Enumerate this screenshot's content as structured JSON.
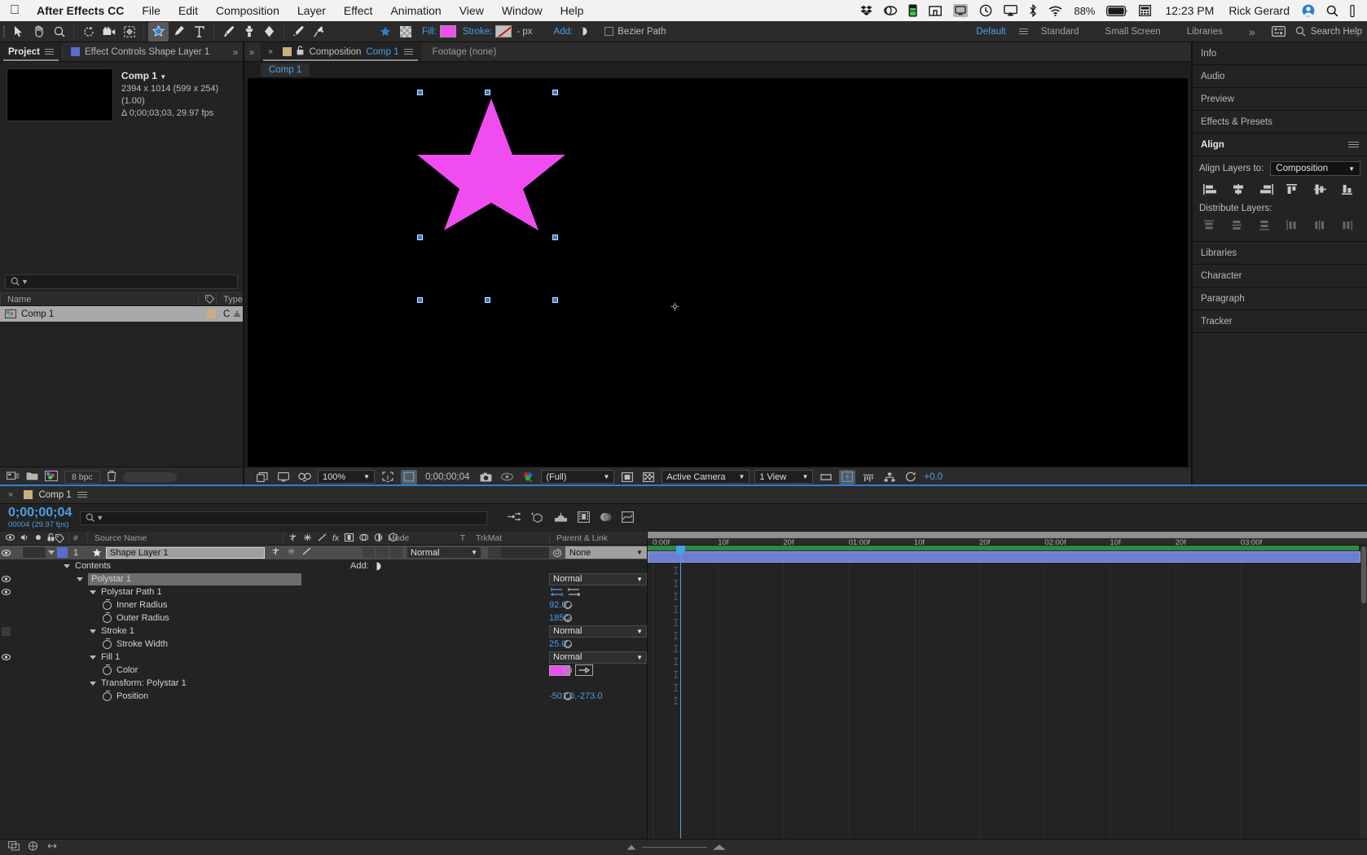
{
  "macbar": {
    "apple_icon": "apple-icon",
    "menus": [
      "After Effects CC",
      "File",
      "Edit",
      "Composition",
      "Layer",
      "Effect",
      "Animation",
      "View",
      "Window",
      "Help"
    ],
    "status_icons": [
      "dropbox-icon",
      "creative-cloud-icon",
      "battery-app-icon",
      "window-manager-icon",
      "display-mirror-icon",
      "time-machine-icon",
      "airplay-icon",
      "bluetooth-icon",
      "wifi-icon"
    ],
    "battery_percent": "88%",
    "clock": "12:23 PM",
    "user": "Rick Gerard",
    "right_icons": [
      "spotlight-icon",
      "notification-center-icon"
    ]
  },
  "toolbar": {
    "tools": [
      "selection-tool",
      "hand-tool",
      "zoom-tool",
      "rotation-tool",
      "camera-tool",
      "pan-behind-tool",
      "star-shape-tool",
      "pen-tool",
      "type-tool",
      "brush-tool",
      "clone-stamp-tool",
      "eraser-tool",
      "roto-brush-tool",
      "puppet-pin-tool"
    ],
    "active_tool": "star-shape-tool",
    "fill_label": "Fill:",
    "fill_color": "#ef4df0",
    "stroke_label": "Stroke:",
    "stroke_color": "none",
    "stroke_width": "- px",
    "add_label": "Add:",
    "bezier_label": "Bezier Path",
    "workspaces": [
      "Default",
      "Standard",
      "Small Screen",
      "Libraries"
    ],
    "active_workspace": "Default",
    "overflow": "»",
    "search_placeholder": "Search Help"
  },
  "project": {
    "tabs": [
      {
        "label": "Project",
        "active": true,
        "icon": "hamburger-icon"
      },
      {
        "label": "Effect Controls Shape Layer 1",
        "active": false,
        "icon": "blue-square-icon"
      }
    ],
    "comp_name": "Comp 1",
    "comp_dims": "2394 x 1014  (599 x 254) (1.00)",
    "comp_duration": "Δ 0;00;03;03, 29.97 fps",
    "search_placeholder": "",
    "columns": [
      "Name",
      "tag-icon",
      "Type"
    ],
    "rows": [
      {
        "name": "Comp 1",
        "type": "C",
        "selected": true
      }
    ],
    "footer": {
      "bit_depth": "8 bpc",
      "icons": [
        "interpret-footage-icon",
        "new-folder-icon",
        "new-comp-icon",
        "delete-icon"
      ]
    }
  },
  "comp_viewer": {
    "tabs": [
      {
        "label": "Composition",
        "value": "Comp 1",
        "active": true
      },
      {
        "label": "Footage (none)",
        "value": "",
        "active": false
      }
    ],
    "breadcrumb": "Comp 1",
    "footer": {
      "magnification": "100%",
      "timecode": "0;00;00;04",
      "resolution": "(Full)",
      "view": "Active Camera",
      "view_layout": "1 View",
      "exposure": "+0.0",
      "icons": [
        "always-preview-icon",
        "main-viewer-icon",
        "3d-glasses-icon",
        "region-of-interest-icon",
        "transparency-grid-icon",
        "take-snapshot-icon",
        "show-snapshot-icon",
        "channel-icon",
        "mask-icon",
        "toggle-grid-icon",
        "renderer-icon",
        "pixel-aspect-icon",
        "fast-preview-icon",
        "timeline-icon",
        "comp-flowchart-icon",
        "reset-exposure-icon"
      ]
    }
  },
  "right_panels": {
    "collapsed_top": [
      "Info",
      "Audio",
      "Preview",
      "Effects & Presets"
    ],
    "align": {
      "title": "Align",
      "menu_icon": "hamburger-icon",
      "align_to_label": "Align Layers to:",
      "align_to_value": "Composition",
      "align_icons": [
        "align-left-icon",
        "align-horizontal-center-icon",
        "align-right-icon",
        "align-top-icon",
        "align-vertical-center-icon",
        "align-bottom-icon"
      ],
      "distribute_label": "Distribute Layers:",
      "distribute_icons": [
        "distribute-top-icon",
        "distribute-vertical-center-icon",
        "distribute-bottom-icon",
        "distribute-left-icon",
        "distribute-horizontal-center-icon",
        "distribute-right-icon"
      ]
    },
    "collapsed_bottom": [
      "Libraries",
      "Character",
      "Paragraph",
      "Tracker"
    ]
  },
  "timeline": {
    "tab_label": "Comp 1",
    "current_time": "0;00;00;04",
    "current_frame": "00004 (29.97 fps)",
    "search_placeholder": "",
    "header_icons": [
      "live-update-icon",
      "draft-3d-icon",
      "hide-shy-icon",
      "frame-blending-icon",
      "motion-blur-icon",
      "graph-editor-icon"
    ],
    "columns": {
      "av": [
        "eye-icon",
        "audio-icon",
        "solo-icon",
        "lock-icon"
      ],
      "label": "tag-icon",
      "index": "#",
      "source_name": "Source Name",
      "switches": [
        "shy-icon",
        "collapse-icon",
        "quality-icon",
        "effects-icon",
        "frame-blend-icon",
        "motion-blur-icon",
        "adjustment-icon",
        "3d-layer-icon"
      ],
      "mode": "Mode",
      "t": "T",
      "trkmat": "TrkMat",
      "parent": "Parent & Link"
    },
    "layer": {
      "index": "1",
      "name": "Shape Layer 1",
      "mode": "Normal",
      "parent": "None",
      "icon": "star-icon"
    },
    "properties": [
      {
        "indent": 1,
        "label": "Contents",
        "value": "",
        "add_label": "Add:",
        "type": "group",
        "eye": false,
        "twirl": true
      },
      {
        "indent": 2,
        "label": "Polystar 1",
        "value": "Normal",
        "type": "select",
        "eye": true,
        "twirl": true,
        "highlight": true
      },
      {
        "indent": 3,
        "label": "Polystar Path 1",
        "value": "",
        "type": "path",
        "eye": true,
        "twirl": true
      },
      {
        "indent": 4,
        "label": "Inner Radius",
        "value": "92.6",
        "type": "number",
        "stopwatch": true
      },
      {
        "indent": 4,
        "label": "Outer Radius",
        "value": "185.2",
        "type": "number",
        "stopwatch": true
      },
      {
        "indent": 3,
        "label": "Stroke 1",
        "value": "Normal",
        "type": "select",
        "eye": false,
        "twirl": true,
        "eyebox": true
      },
      {
        "indent": 4,
        "label": "Stroke Width",
        "value": "25.0",
        "type": "number",
        "stopwatch": true
      },
      {
        "indent": 3,
        "label": "Fill 1",
        "value": "Normal",
        "type": "select",
        "eye": true,
        "twirl": true
      },
      {
        "indent": 4,
        "label": "Color",
        "value": "",
        "type": "color",
        "color": "#ef4df0",
        "stopwatch": true
      },
      {
        "indent": 3,
        "label": "Transform: Polystar 1",
        "value": "",
        "type": "group",
        "twirl": true
      },
      {
        "indent": 4,
        "label": "Position",
        "value": "-501.0,-273.0",
        "type": "number",
        "stopwatch": true
      }
    ],
    "ruler_ticks": [
      "0:00f",
      "10f",
      "20f",
      "01:00f",
      "10f",
      "20f",
      "02:00f",
      "10f",
      "20f",
      "03:00f"
    ],
    "footer_icons": [
      "toggle-switches-icon",
      "comp-render-icon",
      "motion-blur-toggle-icon"
    ],
    "zoom": {
      "out_icon": "zoom-out-icon",
      "in_icon": "zoom-in-icon"
    }
  },
  "canvas": {
    "shape": "star",
    "fill_color": "#ef4df0",
    "selection_handles": 8,
    "anchor_point_icon": "anchor-point-icon"
  },
  "colors": {
    "accent_blue": "#4b9fe8",
    "magenta": "#ef4df0",
    "panel_bg": "#232323",
    "toolbar_bg": "#2b2b2b",
    "layer_bar": "#6d7fcf",
    "work_area": "#8e8e8e"
  }
}
